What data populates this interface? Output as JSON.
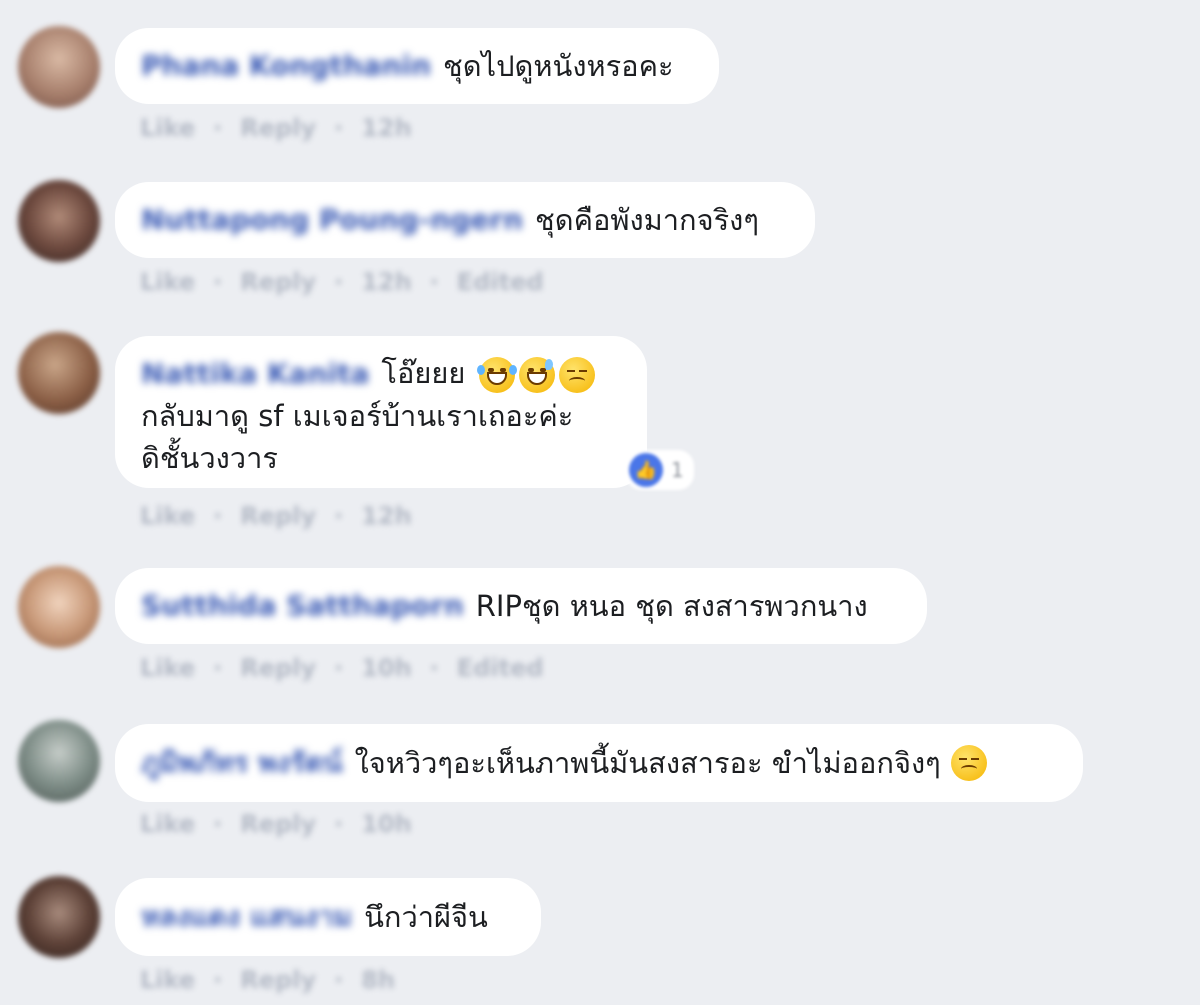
{
  "comments": [
    {
      "author": "Phana Kongthanin",
      "lines": [
        "ชุดไปดูหนังหรอคะ"
      ],
      "actions": {
        "like": "Like",
        "reply": "Reply",
        "time": "12h",
        "edited": ""
      }
    },
    {
      "author": "Nuttapong Poung-ngern",
      "lines": [
        "ชุดคือพังมากจริงๆ"
      ],
      "actions": {
        "like": "Like",
        "reply": "Reply",
        "time": "12h",
        "edited": "Edited"
      }
    },
    {
      "author": "Nattika Kanita",
      "lines": [
        "โอ๊ยยย",
        "กลับมาดู sf เมเจอร์บ้านเราเถอะค่ะ",
        "ดิชั้นวงวาร"
      ],
      "emojis": [
        "laughing-tears-emoji",
        "sweat-smile-emoji",
        "sleepy-emoji"
      ],
      "reaction": {
        "icon": "like-icon",
        "count": "1"
      },
      "actions": {
        "like": "Like",
        "reply": "Reply",
        "time": "12h",
        "edited": ""
      }
    },
    {
      "author": "Sutthida Satthaporn",
      "lines": [
        "RIPชุด หนอ ชุด สงสารพวกนาง"
      ],
      "actions": {
        "like": "Like",
        "reply": "Reply",
        "time": "10h",
        "edited": "Edited"
      }
    },
    {
      "author": "ภูมิพภัทร พงรัตน์",
      "lines": [
        "ใจหวิวๆอะเห็นภาพนี้มันสงสารอะ ขำไม่ออกจิงๆ"
      ],
      "emojis": [
        "disappointed-emoji"
      ],
      "actions": {
        "like": "Like",
        "reply": "Reply",
        "time": "10h",
        "edited": ""
      }
    },
    {
      "author": "หลงแดง แสนงาม",
      "lines": [
        "นึกว่าผีจีน"
      ],
      "actions": {
        "like": "Like",
        "reply": "Reply",
        "time": "8h",
        "edited": ""
      }
    }
  ],
  "colors": {
    "background": "#eceef2",
    "bubble": "#ffffff",
    "author_link": "#3b5bb5",
    "meta_text": "#b4bac6",
    "like_blue": "#4a76e8"
  }
}
